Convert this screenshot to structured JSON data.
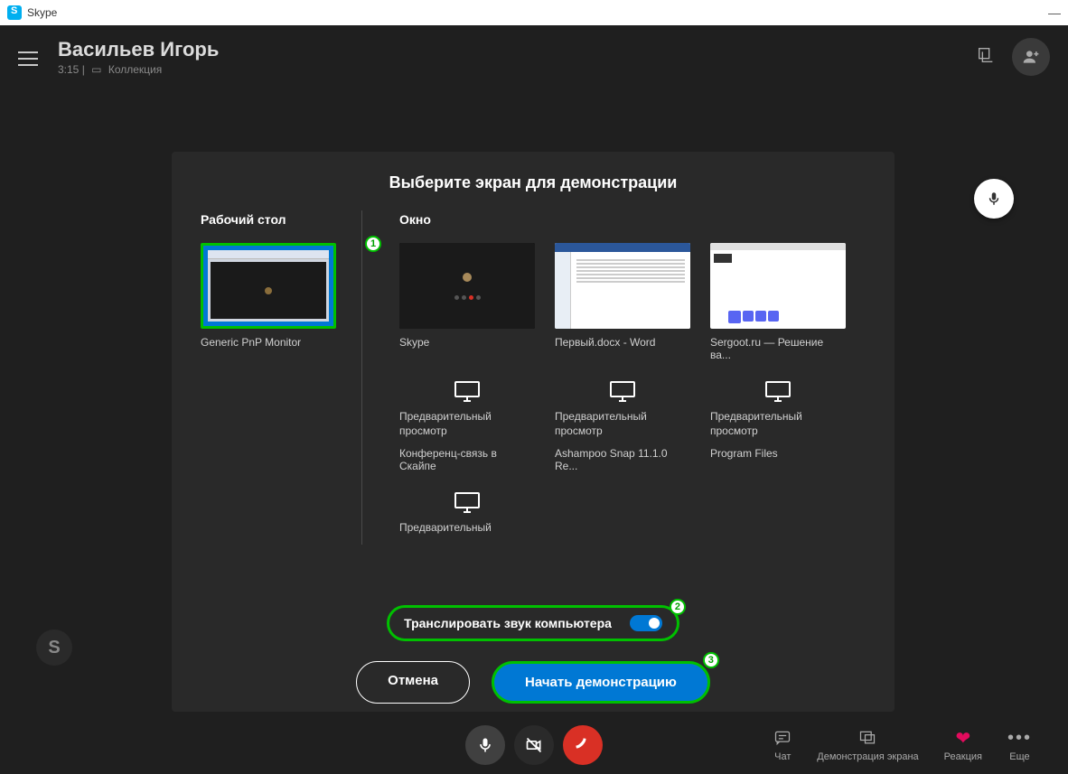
{
  "window": {
    "title": "Skype"
  },
  "header": {
    "user_name": "Васильев Игорь",
    "time": "3:15",
    "collection": "Коллекция"
  },
  "share_panel": {
    "title": "Выберите экран для демонстрации",
    "desktop_label": "Рабочий стол",
    "window_label": "Окно",
    "desktop_item": "Generic PnP Monitor",
    "windows": [
      {
        "label": "Skype"
      },
      {
        "label": "Первый.docx - Word"
      },
      {
        "label": "Sergoot.ru — Решение ва..."
      }
    ],
    "previews": [
      {
        "label": "Конференц-связь в Скайпе",
        "text": "Предварительный просмотр"
      },
      {
        "label": "Ashampoo Snap 11.1.0 Re...",
        "text": "Предварительный просмотр"
      },
      {
        "label": "Program Files",
        "text": "Предварительный просмотр"
      }
    ],
    "preview_extra_text": "Предварительный",
    "audio_toggle_label": "Транслировать звук компьютера",
    "cancel": "Отмена",
    "start": "Начать демонстрацию",
    "badges": {
      "desktop": "1",
      "audio": "2",
      "start": "3"
    }
  },
  "bottom": {
    "chat": "Чат",
    "screen_share": "Демонстрация экрана",
    "reaction": "Реакция",
    "more": "Еще"
  },
  "corner_letter": "S"
}
